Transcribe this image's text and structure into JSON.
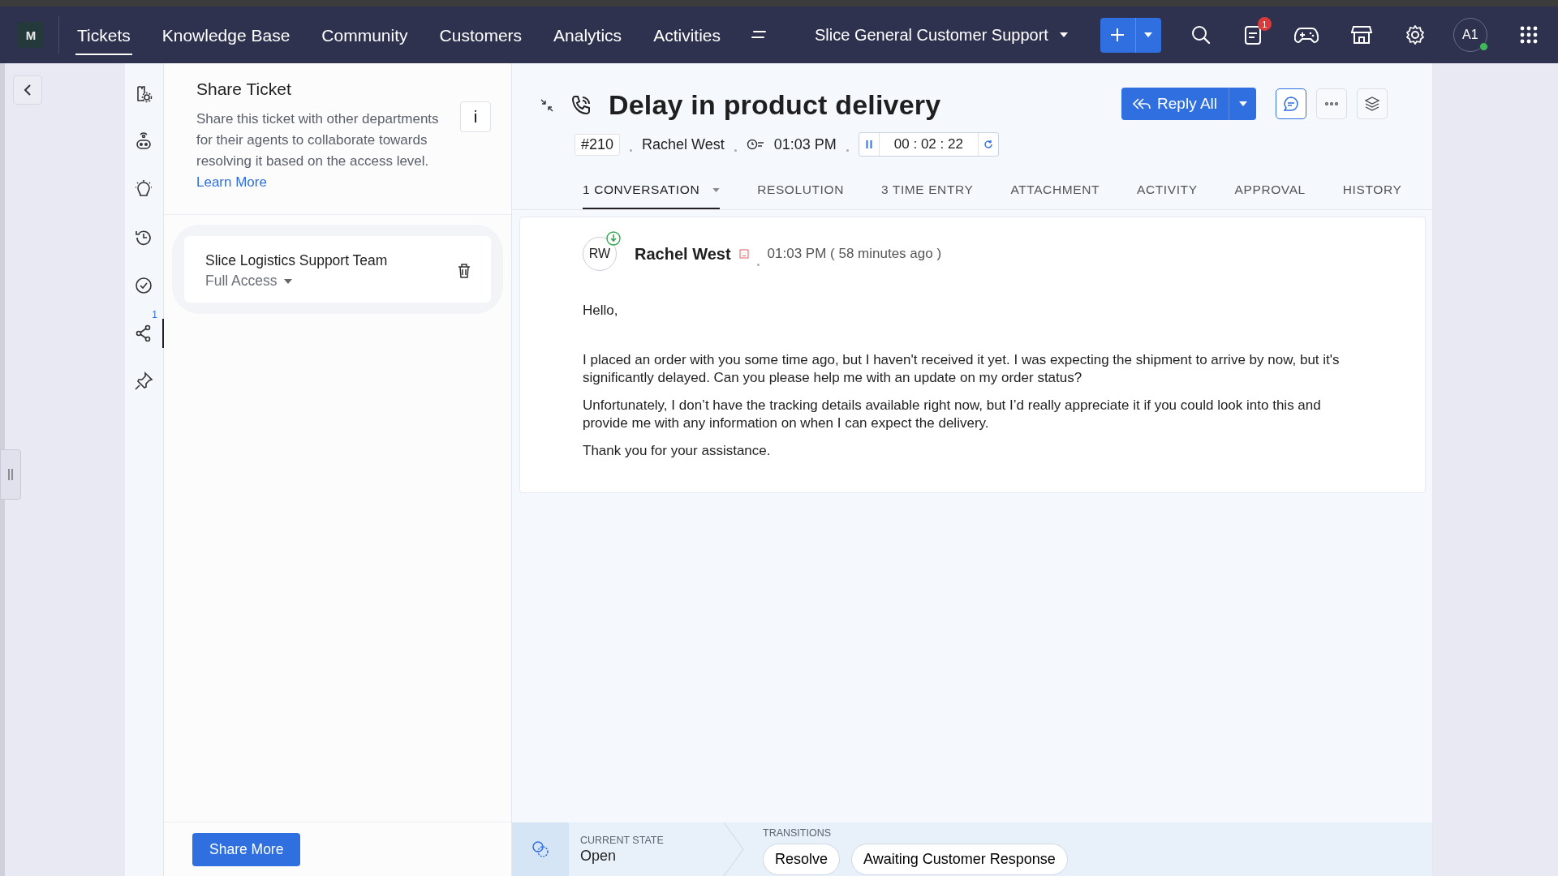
{
  "top_bar": {
    "logo": "M",
    "nav": [
      {
        "label": "Tickets",
        "selected": true
      },
      {
        "label": "Knowledge Base",
        "selected": false
      },
      {
        "label": "Community",
        "selected": false
      },
      {
        "label": "Customers",
        "selected": false
      },
      {
        "label": "Analytics",
        "selected": false
      },
      {
        "label": "Activities",
        "selected": false
      }
    ],
    "department": "Slice General Customer Support",
    "notification_badge": "1",
    "avatar": {
      "initials": "A1",
      "online": true
    }
  },
  "rail": [
    {
      "kind": "settings-doc",
      "selected": false
    },
    {
      "kind": "bot",
      "selected": false
    },
    {
      "kind": "bulb",
      "selected": false
    },
    {
      "kind": "history",
      "selected": false
    },
    {
      "kind": "check",
      "selected": false
    },
    {
      "kind": "share",
      "selected": true,
      "badge": "1"
    },
    {
      "kind": "pin",
      "selected": false
    }
  ],
  "share_panel": {
    "title": "Share Ticket",
    "info_button": "i",
    "description": "Share this ticket with other departments for their agents to collaborate towards resolving it based on the access level.",
    "link": "Learn More",
    "shared": [
      {
        "name": "Slice Logistics Support Team",
        "access": "Full Access"
      }
    ],
    "button": "Share More"
  },
  "ticket": {
    "subject": "Delay in product delivery",
    "id": "#210",
    "contact": "Rachel West",
    "time": "01:03 PM",
    "timer": "00 : 02 : 22",
    "reply_button": "Reply All",
    "tabs": [
      {
        "label": "1 CONVERSATION",
        "selected": true,
        "dropdown": true
      },
      {
        "label": "RESOLUTION",
        "selected": false
      },
      {
        "label": "3 TIME ENTRY",
        "selected": false
      },
      {
        "label": "ATTACHMENT",
        "selected": false
      },
      {
        "label": "ACTIVITY",
        "selected": false
      },
      {
        "label": "APPROVAL",
        "selected": false
      },
      {
        "label": "HISTORY",
        "selected": false
      }
    ],
    "message": {
      "initials": "RW",
      "sender": "Rachel West",
      "time": "01:03 PM ( 58 minutes ago )",
      "paragraphs": [
        "Hello,",
        "I placed an order with you some time ago, but I haven't received it yet. I was expecting the shipment to arrive by now, but it's significantly delayed. Can you please help me with an update on my order status?",
        "Unfortunately, I don’t have the tracking details available right now, but I’d really appreciate it if you could look into this and provide me with any information on when I can expect the delivery.",
        "Thank you for your assistance."
      ]
    }
  },
  "status_bar": {
    "current_state_label": "CURRENT STATE",
    "current_state": "Open",
    "transitions_label": "TRANSITIONS",
    "transitions": [
      "Resolve",
      "Awaiting Customer Response"
    ]
  }
}
